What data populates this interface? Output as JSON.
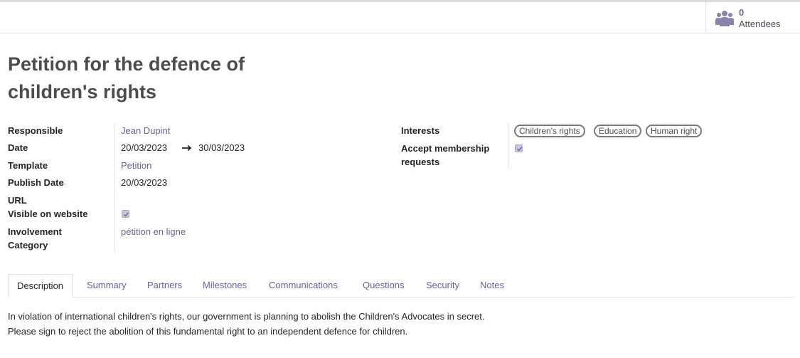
{
  "stat": {
    "value": "0",
    "label": "Attendees",
    "icon": "users-icon"
  },
  "title": "Petition for the defence of children's rights",
  "left_fields": {
    "responsible": {
      "label": "Responsible",
      "value": "Jean Dupint"
    },
    "date": {
      "label": "Date",
      "start": "20/03/2023",
      "end": "30/03/2023"
    },
    "template": {
      "label": "Template",
      "value": "Petition"
    },
    "publish_date": {
      "label": "Publish Date",
      "value": "20/03/2023"
    },
    "url": {
      "label": "URL",
      "value": ""
    },
    "visible": {
      "label": "Visible on website",
      "checked": true
    },
    "involvement": {
      "label_line1": "Involvement",
      "label_line2": "Category",
      "value": "pétition en ligne"
    }
  },
  "right_fields": {
    "interests": {
      "label": "Interests",
      "tags": [
        "Children's rights",
        "Education",
        "Human right"
      ]
    },
    "accept": {
      "label_line1": "Accept membership",
      "label_line2": "requests",
      "checked": true
    }
  },
  "tabs": [
    "Description",
    "Summary",
    "Partners",
    "Milestones",
    "Communications",
    "Questions",
    "Security",
    "Notes"
  ],
  "active_tab": "Description",
  "description": {
    "line1": "In violation of international children's rights, our government is planning to abolish the Children's Advocates in secret.",
    "line2": "Please sign to reject the abolition of this fundamental right to an independent defence for children."
  },
  "colors": {
    "accent": "#6a5f93",
    "checkbox": "#c9c3dd",
    "border": "#dee2e6"
  }
}
